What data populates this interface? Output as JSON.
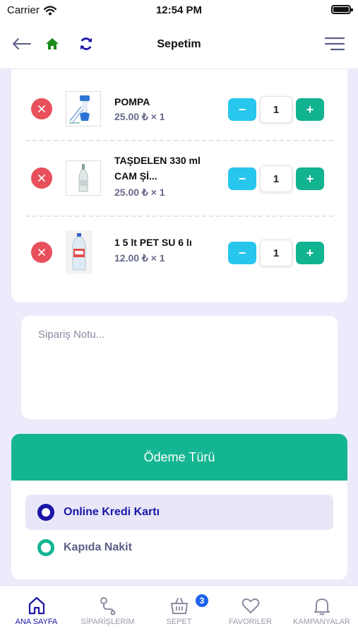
{
  "status_bar": {
    "carrier": "Carrier",
    "time": "12:54 PM"
  },
  "header": {
    "title": "Sepetim"
  },
  "cart": {
    "items": [
      {
        "name_line1": "POMPA",
        "name_line2": "",
        "price": "25.00 ₺ × 1",
        "quantity": "1",
        "minus": "−",
        "plus": "+"
      },
      {
        "name_line1": "TAŞDELEN 330 ml",
        "name_line2": "CAM Şİ...",
        "price": "25.00 ₺ × 1",
        "quantity": "1",
        "minus": "−",
        "plus": "+"
      },
      {
        "name_line1": "1 5 lt PET SU 6 lı",
        "name_line2": "",
        "price": "12.00 ₺ × 1",
        "quantity": "1",
        "minus": "−",
        "plus": "+"
      }
    ]
  },
  "order_note": {
    "placeholder": "Sipariş Notu...",
    "value": ""
  },
  "payment": {
    "title": "Ödeme Türü",
    "options": [
      {
        "label": "Online Kredi Kartı",
        "selected": true
      },
      {
        "label": "Kapıda Nakit",
        "selected": false
      }
    ]
  },
  "tab_bar": {
    "tabs": [
      {
        "label": "ANA SAYFA",
        "icon": "home-icon",
        "active": true
      },
      {
        "label": "SİPARİŞLERİM",
        "icon": "route-icon",
        "active": false
      },
      {
        "label": "SEPET",
        "icon": "basket-icon",
        "active": false,
        "badge": "3"
      },
      {
        "label": "FAVORİLER",
        "icon": "heart-icon",
        "active": false
      },
      {
        "label": "KAMPANYALAR",
        "icon": "bell-icon",
        "active": false
      }
    ]
  },
  "colors": {
    "accent": "#1b15a8",
    "green": "#12b391",
    "cyan": "#27c6ec",
    "danger": "#e8505b",
    "background": "#ebebfb"
  }
}
